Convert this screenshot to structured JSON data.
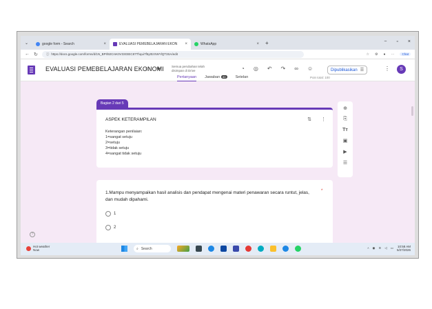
{
  "browser": {
    "tabs": [
      {
        "label": "google form - Search",
        "close": "×"
      },
      {
        "label": "EVALUASI PEMEBELAJARAN EKON",
        "close": "×"
      },
      {
        "label": "WhatsApp",
        "close": "×"
      }
    ],
    "new_tab": "+",
    "window_controls": [
      "−",
      "▫",
      "×"
    ],
    "url": "https://docs.google.com/forms/d/1N_BPrl92CmK0V33GtEC87Thqui7f5yt0zXWYlQT3SA/edit",
    "chat_label": "Chat"
  },
  "form_header": {
    "title": "EVALUASI PEMEBELAJARAN EKONOMI",
    "saved_text": "Semua perubahan telah disimpan di Drive",
    "publish_label": "Dipublikasikan",
    "avatar_letter": "S",
    "tabs": [
      "Pertanyaan",
      "Jawaban",
      "Setelan"
    ],
    "responses_badge": "80",
    "points": "Poin total: 100"
  },
  "section": {
    "badge": "Bagian 2 dari 5",
    "title": "ASPEK KETERAMPILAN",
    "description": [
      "Keterangan penilaian:",
      "1=sangat setuju",
      "2=setuju",
      "3=tidak setuju",
      "4=sangat tidak setuju"
    ]
  },
  "question": {
    "text": "1.Mampu menyampaikan hasil analisis dan pendapat mengenai materi penawaran secara runtut, jelas, dan mudah dipahami.",
    "required_mark": "*",
    "options": [
      "1",
      "2"
    ]
  },
  "taskbar": {
    "weather_title": "Hot weather",
    "weather_sub": "Now",
    "search_label": "Search",
    "time": "10:58 AM",
    "date": "5/27/2026"
  },
  "colors": {
    "accent": "#673ab7",
    "background": "#f6e9f6"
  }
}
